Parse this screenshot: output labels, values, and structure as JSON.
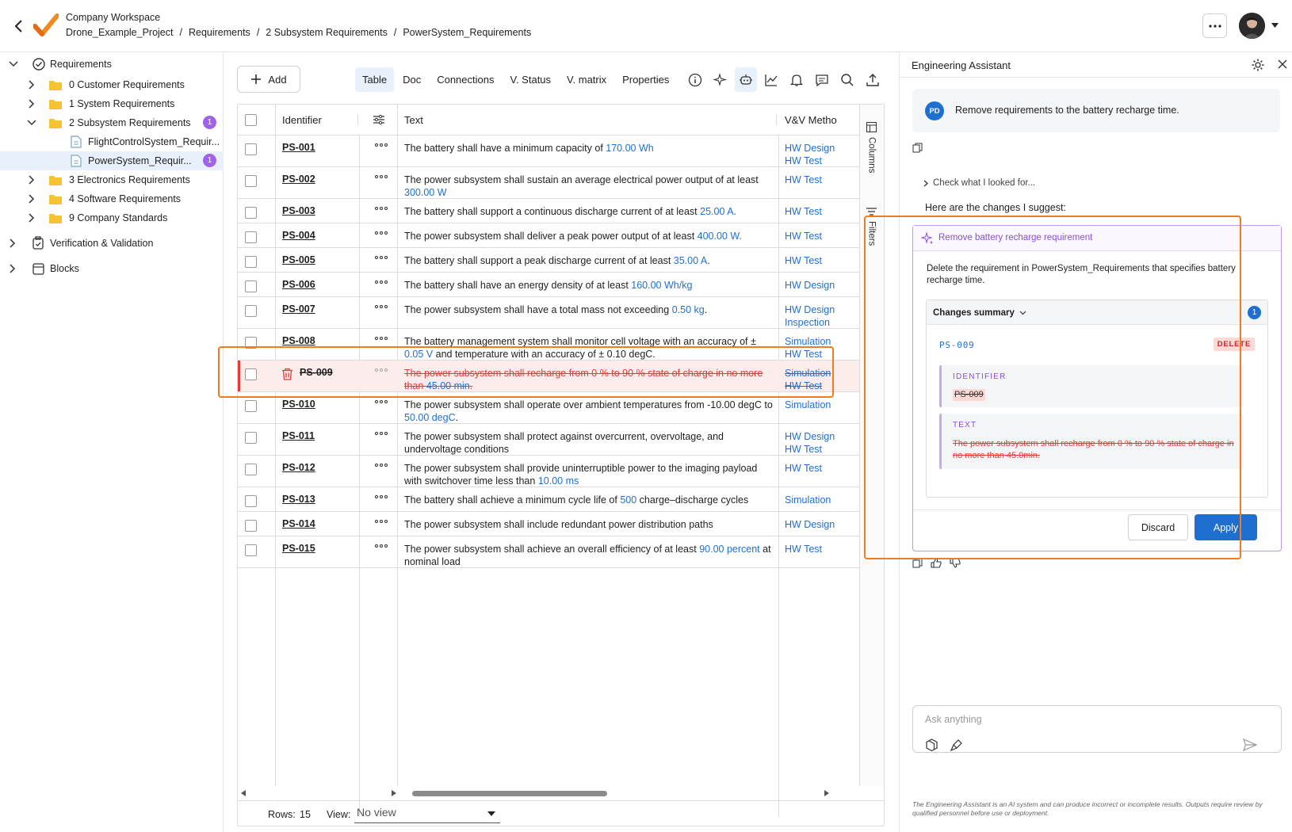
{
  "header": {
    "workspace": "Company Workspace",
    "breadcrumb": [
      "Drone_Example_Project",
      "Requirements",
      "2 Subsystem Requirements",
      "PowerSystem_Requirements"
    ],
    "separator": "/"
  },
  "sidebar": {
    "root": "Requirements",
    "items": [
      {
        "label": "0 Customer Requirements"
      },
      {
        "label": "1 System Requirements"
      },
      {
        "label": "2 Subsystem Requirements",
        "badge": "1"
      },
      {
        "label": "FlightControlSystem_Requir..."
      },
      {
        "label": "PowerSystem_Requir...",
        "badge": "1"
      },
      {
        "label": "3 Electronics Requirements"
      },
      {
        "label": "4 Software Requirements"
      },
      {
        "label": "9 Company Standards"
      }
    ],
    "vv": "Verification & Validation",
    "blocks": "Blocks"
  },
  "toolbar": {
    "add": "Add",
    "tabs": [
      "Table",
      "Doc",
      "Connections",
      "V. Status",
      "V. matrix",
      "Properties"
    ]
  },
  "table": {
    "headers": {
      "identifier": "Identifier",
      "text": "Text",
      "vv": "V&V Metho"
    },
    "side_tabs": {
      "columns": "Columns",
      "filters": "Filters"
    },
    "rows": [
      {
        "id": "PS-001",
        "parts": [
          "The battery shall have a minimum capacity of ",
          "170.00  Wh",
          ""
        ],
        "vv": [
          "HW Design",
          "HW Test"
        ]
      },
      {
        "id": "PS-002",
        "parts": [
          "The power subsystem shall sustain an average electrical power output of at least ",
          "300.00  W",
          ""
        ],
        "vv": [
          "HW Test"
        ]
      },
      {
        "id": "PS-003",
        "parts": [
          "The battery shall support a continuous discharge current of at least ",
          "25.00  A.",
          ""
        ],
        "vv": [
          "HW Test"
        ]
      },
      {
        "id": "PS-004",
        "parts": [
          "The power subsystem shall deliver a peak power output of at least ",
          "400.00  W.",
          ""
        ],
        "vv": [
          "HW Test"
        ]
      },
      {
        "id": "PS-005",
        "parts": [
          "The battery shall support a peak discharge current of at least ",
          "35.00  A",
          "."
        ],
        "vv": [
          "HW Test"
        ]
      },
      {
        "id": "PS-006",
        "parts": [
          "The battery shall have an energy density of at least ",
          "160.00  Wh/kg",
          ""
        ],
        "vv": [
          "HW Design"
        ]
      },
      {
        "id": "PS-007",
        "parts": [
          "The power subsystem shall have a total mass not exceeding ",
          "0.50  kg",
          "."
        ],
        "vv": [
          "HW Design",
          "Inspection"
        ]
      },
      {
        "id": "PS-008",
        "parts": [
          "The battery management system shall monitor cell voltage with an accuracy of ± ",
          "0.05  V",
          " and temperature with an accuracy of ± 0.10  degC."
        ],
        "vv": [
          "Simulation",
          "HW Test"
        ]
      },
      {
        "id": "PS-009",
        "parts": [
          "The power subsystem shall recharge from 0 % to 90 % state of charge in no more than ",
          "45.00  min",
          "."
        ],
        "vv": [
          "Simulation",
          "HW Test"
        ],
        "deleted": true
      },
      {
        "id": "PS-010",
        "parts": [
          "The power subsystem shall operate over ambient temperatures from -10.00  degC to ",
          "50.00  degC",
          "."
        ],
        "vv": [
          "Simulation"
        ]
      },
      {
        "id": "PS-011",
        "parts": [
          "The power subsystem shall protect against overcurrent, overvoltage, and undervoltage conditions",
          "",
          ""
        ],
        "vv": [
          "HW Design",
          "HW Test"
        ]
      },
      {
        "id": "PS-012",
        "parts": [
          "The power subsystem shall provide uninterruptible power to the imaging payload with switchover time less than ",
          "10.00  ms",
          ""
        ],
        "vv": [
          "HW Test"
        ]
      },
      {
        "id": "PS-013",
        "parts": [
          "The battery shall achieve a minimum cycle life of ",
          "500",
          " charge–discharge cycles"
        ],
        "vv": [
          "Simulation"
        ]
      },
      {
        "id": "PS-014",
        "parts": [
          "The power subsystem shall include redundant power distribution paths",
          "",
          ""
        ],
        "vv": [
          "HW Design"
        ]
      },
      {
        "id": "PS-015",
        "parts": [
          "The power subsystem shall achieve an overall efficiency of at least ",
          "90.00  percent",
          " at nominal load"
        ],
        "vv": [
          "HW Test"
        ]
      }
    ],
    "footer": {
      "rows_label": "Rows:",
      "rows_count": "15",
      "view_label": "View:",
      "view_value": "No view"
    }
  },
  "assistant": {
    "title": "Engineering Assistant",
    "user_initials": "PD",
    "user_message": "Remove requirements to the battery recharge time.",
    "check_looked": "Check what I looked for...",
    "suggest": "Here are the changes I suggest:",
    "card": {
      "title": "Remove battery recharge requirement",
      "description": "Delete the requirement in PowerSystem_Requirements that specifies battery recharge time.",
      "summary_label": "Changes summary",
      "summary_count": "1",
      "item_id": "PS-009",
      "action": "DELETE",
      "identifier_label": "IDENTIFIER",
      "identifier_value": "PS-009",
      "text_label": "TEXT",
      "text_value": "The power subsystem shall recharge from 0 % to 90 % state of charge in no more than 45.0min.",
      "discard": "Discard",
      "apply": "Apply"
    },
    "input_placeholder": "Ask anything",
    "disclaimer": "The Engineering Assistant is an AI system and can produce incorrect or incomplete results. Outputs require review by qualified personnel before use or deployment."
  },
  "colors": {
    "accent": "#1f6fd1",
    "delete": "#e53935",
    "highlight": "#f07c1f",
    "ai": "#8a4fd8"
  }
}
